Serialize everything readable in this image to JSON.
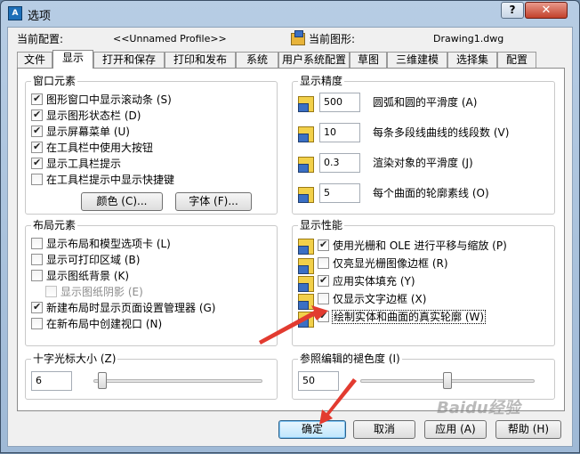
{
  "window": {
    "title": "选项",
    "app_icon": "autocad-icon",
    "help_label": "?",
    "close_label": "✕"
  },
  "config": {
    "profile_label": "当前配置:",
    "profile_value": "<<Unnamed Profile>>",
    "drawing_label": "当前图形:",
    "drawing_value": "Drawing1.dwg"
  },
  "tabs": [
    "文件",
    "显示",
    "打开和保存",
    "打印和发布",
    "系统",
    "用户系统配置",
    "草图",
    "三维建模",
    "选择集",
    "配置"
  ],
  "active_tab": "显示",
  "window_elements": {
    "title": "窗口元素",
    "items": [
      {
        "label": "图形窗口中显示滚动条 (S)",
        "checked": true
      },
      {
        "label": "显示图形状态栏 (D)",
        "checked": true
      },
      {
        "label": "显示屏幕菜单 (U)",
        "checked": true
      },
      {
        "label": "在工具栏中使用大按钮",
        "checked": true
      },
      {
        "label": "显示工具栏提示",
        "checked": true
      },
      {
        "label": "在工具栏提示中显示快捷键",
        "checked": false
      }
    ],
    "colors_button": "颜色 (C)...",
    "fonts_button": "字体 (F)..."
  },
  "layout_elements": {
    "title": "布局元素",
    "items": [
      {
        "label": "显示布局和模型选项卡 (L)",
        "checked": false,
        "disabled": false
      },
      {
        "label": "显示可打印区域 (B)",
        "checked": false,
        "disabled": false
      },
      {
        "label": "显示图纸背景 (K)",
        "checked": false,
        "disabled": false
      },
      {
        "label": "显示图纸阴影 (E)",
        "checked": false,
        "disabled": true
      },
      {
        "label": "新建布局时显示页面设置管理器 (G)",
        "checked": true,
        "disabled": false
      },
      {
        "label": "在新布局中创建视口 (N)",
        "checked": false,
        "disabled": false
      }
    ]
  },
  "display_resolution": {
    "title": "显示精度",
    "items": [
      {
        "value": "500",
        "label": "圆弧和圆的平滑度 (A)"
      },
      {
        "value": "10",
        "label": "每条多段线曲线的线段数 (V)"
      },
      {
        "value": "0.3",
        "label": "渲染对象的平滑度 (J)"
      },
      {
        "value": "5",
        "label": "每个曲面的轮廓素线 (O)"
      }
    ]
  },
  "display_performance": {
    "title": "显示性能",
    "items": [
      {
        "label": "使用光栅和 OLE 进行平移与缩放 (P)",
        "checked": true
      },
      {
        "label": "仅亮显光栅图像边框 (R)",
        "checked": false
      },
      {
        "label": "应用实体填充 (Y)",
        "checked": true
      },
      {
        "label": "仅显示文字边框 (X)",
        "checked": false
      },
      {
        "label": "绘制实体和曲面的真实轮廓 (W)",
        "checked": true
      }
    ]
  },
  "crosshair": {
    "title": "十字光标大小 (Z)",
    "value": "6",
    "fraction": 0.03
  },
  "xref_fade": {
    "title": "参照编辑的褪色度 (I)",
    "value": "50",
    "fraction": 0.5
  },
  "buttons": {
    "ok": "确定",
    "cancel": "取消",
    "apply": "应用 (A)",
    "help": "帮助 (H)"
  },
  "watermark": "Baidu经验",
  "colors": {
    "arrow": "#e23b30",
    "title_bg": "#a9c2de",
    "close": "#c2412b"
  }
}
